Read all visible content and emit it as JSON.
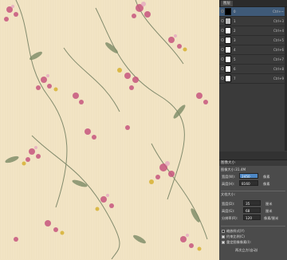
{
  "layers_panel": {
    "tab_label": "图层",
    "layers": [
      {
        "name": "0",
        "shortcut": "Ctrl+~",
        "thumb": "black",
        "selected": true
      },
      {
        "name": "1",
        "shortcut": "Ctrl+3",
        "thumb": "grey",
        "selected": false
      },
      {
        "name": "2",
        "shortcut": "Ctrl+4",
        "thumb": "white",
        "selected": false
      },
      {
        "name": "3",
        "shortcut": "Ctrl+5",
        "thumb": "white",
        "selected": false
      },
      {
        "name": "4",
        "shortcut": "Ctrl+6",
        "thumb": "white",
        "selected": false
      },
      {
        "name": "5",
        "shortcut": "Ctrl+7",
        "thumb": "white",
        "selected": false
      },
      {
        "name": "6",
        "shortcut": "Ctrl+8",
        "thumb": "white",
        "selected": false
      },
      {
        "name": "7",
        "shortcut": "Ctrl+9",
        "thumb": "white",
        "selected": false
      }
    ]
  },
  "image_size_dialog": {
    "title": "图像大小",
    "size_text": "图像大小:31.4M",
    "width_label": "宽度(W):",
    "width_value": "2450",
    "height_label": "高度(H):",
    "height_value": "8160",
    "pixel_unit": "像素",
    "doc_size_label": "文档大小:",
    "doc_width_label": "宽度(D):",
    "doc_width_value": "35",
    "doc_height_label": "高度(G):",
    "doc_height_value": "68",
    "resolution_label": "分辨率(R):",
    "resolution_value": "120",
    "cm_unit": "厘米",
    "res_unit": "像素/厘米",
    "scale_styles_label": "缩放样式(Y)",
    "constrain_label": "约束比例(C)",
    "resample_label": "重定图像像素(I):",
    "resample_method": "两次立方(自动)"
  },
  "colors": {
    "canvas_bg": "#f1e3c3",
    "panel_bg": "#3a3a3a",
    "selected_row": "#3f5a78",
    "highlight_field": "#4d87c4"
  }
}
